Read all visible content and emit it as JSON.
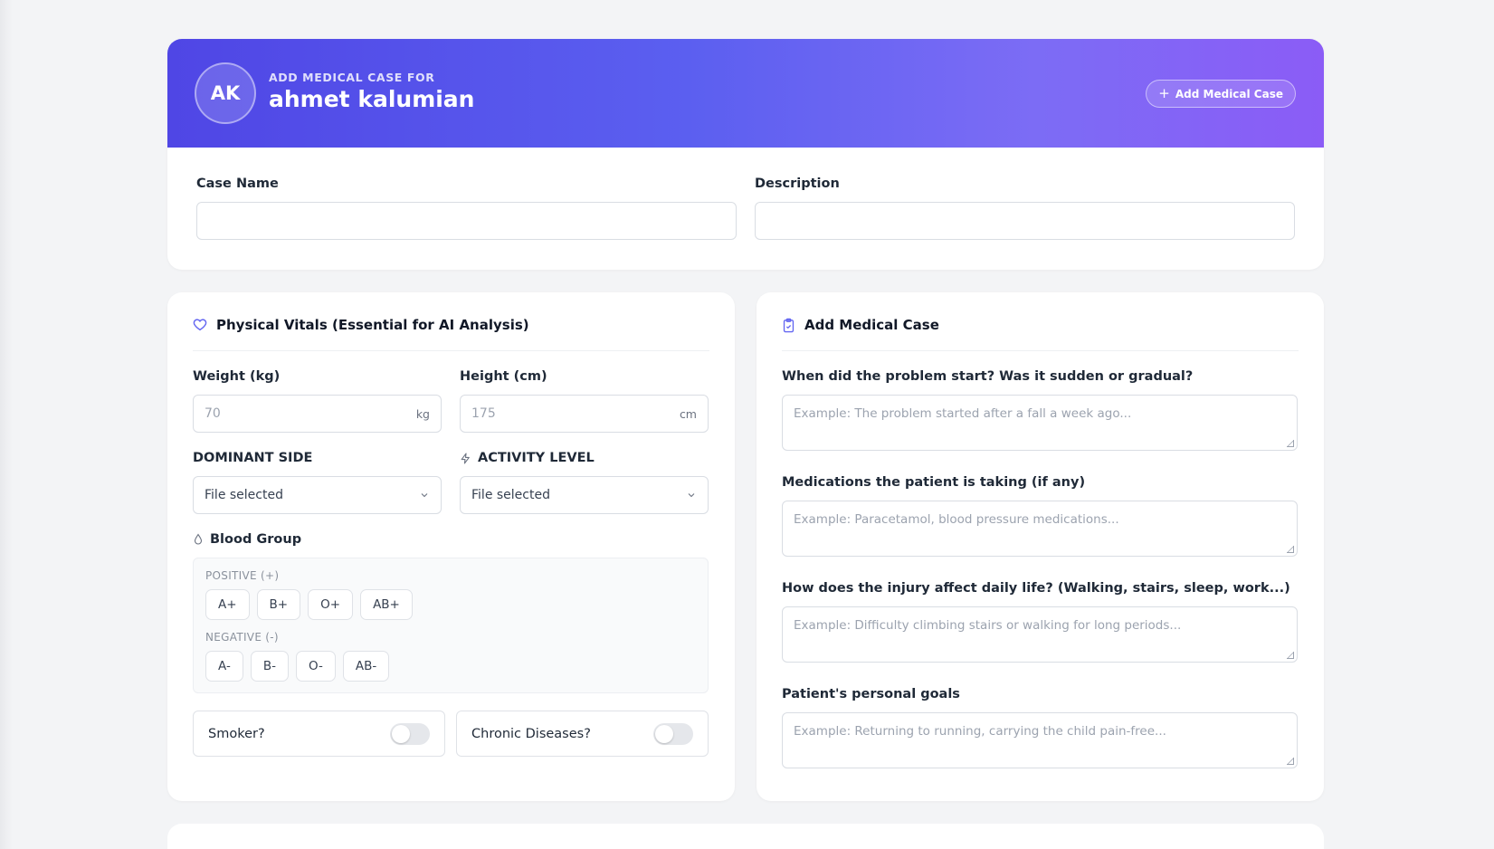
{
  "header": {
    "avatar_initials": "AK",
    "subtitle": "ADD MEDICAL CASE FOR",
    "patient_name": "ahmet kalumian",
    "add_button_label": "Add Medical Case",
    "gradient_colors": [
      "#4f46e5",
      "#8b5cf6"
    ]
  },
  "case_form": {
    "case_name_label": "Case Name",
    "case_name_value": "",
    "description_label": "Description",
    "description_value": ""
  },
  "vitals": {
    "title": "Physical Vitals (Essential for AI Analysis)",
    "icon": "heart-icon",
    "weight": {
      "label": "Weight (kg)",
      "placeholder": "70",
      "unit": "kg"
    },
    "height": {
      "label": "Height (cm)",
      "placeholder": "175",
      "unit": "cm"
    },
    "dominant_side": {
      "label": "DOMINANT SIDE",
      "value": "File selected"
    },
    "activity_level": {
      "label": "ACTIVITY LEVEL",
      "value": "File selected",
      "icon": "bolt-icon"
    },
    "blood_group": {
      "label": "Blood Group",
      "icon": "drop-icon",
      "positive_caption": "POSITIVE (+)",
      "positive": [
        "A+",
        "B+",
        "O+",
        "AB+"
      ],
      "negative_caption": "NEGATIVE (-)",
      "negative": [
        "A-",
        "B-",
        "O-",
        "AB-"
      ]
    },
    "smoker": {
      "label": "Smoker?",
      "on": false
    },
    "chronic": {
      "label": "Chronic Diseases?",
      "on": false
    }
  },
  "medical_case": {
    "title": "Add Medical Case",
    "icon": "clipboard-icon",
    "questions": [
      {
        "label": "When did the problem start? Was it sudden or gradual?",
        "placeholder": "Example: The problem started after a fall a week ago..."
      },
      {
        "label": "Medications the patient is taking (if any)",
        "placeholder": "Example: Paracetamol, blood pressure medications..."
      },
      {
        "label": "How does the injury affect daily life? (Walking, stairs, sleep, work...)",
        "placeholder": "Example: Difficulty climbing stairs or walking for long periods..."
      },
      {
        "label": "Patient's personal goals",
        "placeholder": "Example: Returning to running, carrying the child pain-free..."
      }
    ]
  }
}
